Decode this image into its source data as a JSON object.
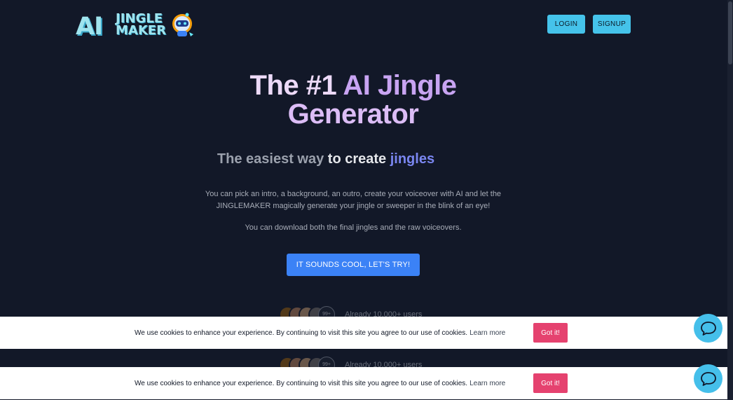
{
  "brand": {
    "logo_ai": "AI",
    "logo_line1": "JINGLE",
    "logo_line2": "MAKER"
  },
  "header": {
    "login_label": "LOGIN",
    "signup_label": "SIGNUP"
  },
  "hero": {
    "title_part1": "The #1 ",
    "title_part2": "AI Jingle",
    "title_part3": "Generator",
    "subtitle_part1": "The easiest way ",
    "subtitle_part2": "to create ",
    "subtitle_part3": "jingles",
    "description": "You can pick an intro, a background, an outro, create your voiceover with AI and let the JINGLEMAKER magically generate your jingle or sweeper in the blink of an eye!",
    "description2": "You can download both the final jingles and the raw voiceovers.",
    "cta_label": "IT SOUNDS COOL, LET'S TRY!"
  },
  "social_proof": {
    "count_badge": "99+",
    "text": "Already 10,000+ users"
  },
  "cookie": {
    "message": "We use cookies to enhance your experience. By continuing to visit this site you agree to our use of cookies.",
    "learn_more": "Learn more",
    "button_label": "Got it!"
  },
  "icons": {
    "chat": "chat-bubble-icon",
    "robot": "robot-mascot-icon"
  },
  "colors": {
    "background": "#121828",
    "accent_cyan": "#45c3ea",
    "cta_blue": "#3b82f6",
    "cookie_button": "#e5426f",
    "title_purple": "#c8a4f2",
    "jingles_blue": "#7a86f0"
  }
}
